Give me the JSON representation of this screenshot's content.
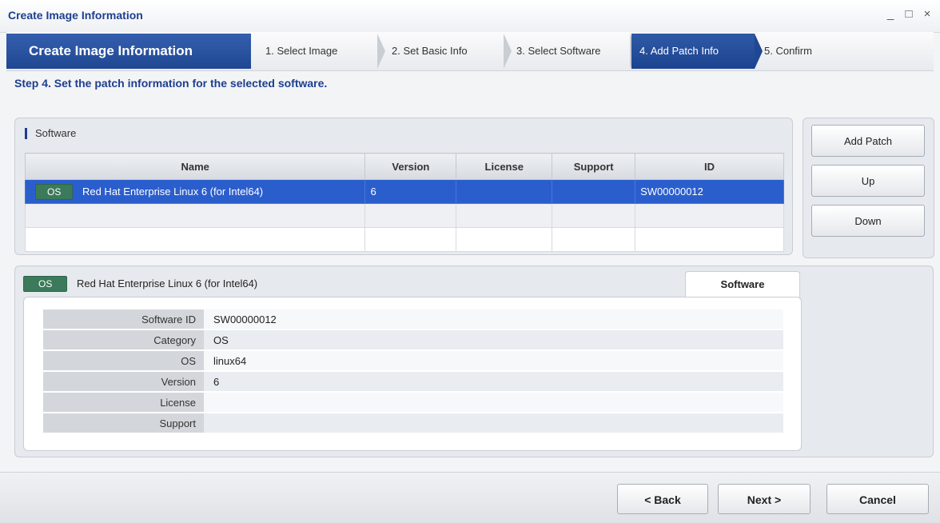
{
  "window": {
    "title": "Create Image Information",
    "controls": [
      "_",
      "□",
      "×"
    ]
  },
  "wizard": {
    "title": "Create Image Information",
    "steps": [
      {
        "label": "1. Select Image",
        "active": false
      },
      {
        "label": "2. Set Basic Info",
        "active": false
      },
      {
        "label": "3. Select Software",
        "active": false
      },
      {
        "label": "4. Add Patch Info",
        "active": true
      },
      {
        "label": "5. Confirm",
        "active": false
      }
    ]
  },
  "step_heading": "Step 4. Set the patch information for the selected software.",
  "software_panel": {
    "label": "Software",
    "columns": [
      "Name",
      "Version",
      "License",
      "Support",
      "ID"
    ],
    "rows": [
      {
        "badge": "OS",
        "name": "Red Hat Enterprise Linux 6 (for Intel64)",
        "version": "6",
        "license": "",
        "support": "",
        "id": "SW00000012",
        "selected": true
      }
    ]
  },
  "side_buttons": {
    "add_patch": "Add Patch",
    "up": "Up",
    "down": "Down"
  },
  "detail": {
    "badge": "OS",
    "name": "Red Hat Enterprise Linux 6 (for Intel64)",
    "tab": "Software",
    "properties": [
      {
        "label": "Software ID",
        "value": "SW00000012"
      },
      {
        "label": "Category",
        "value": "OS"
      },
      {
        "label": "OS",
        "value": "linux64"
      },
      {
        "label": "Version",
        "value": "6"
      },
      {
        "label": "License",
        "value": ""
      },
      {
        "label": "Support",
        "value": ""
      }
    ]
  },
  "footer": {
    "back": "< Back",
    "next": "Next >",
    "cancel": "Cancel"
  },
  "colors": {
    "accent": "#1d3f8f",
    "selected_row": "#2b5ecd",
    "os_badge": "#3b7a5a"
  }
}
